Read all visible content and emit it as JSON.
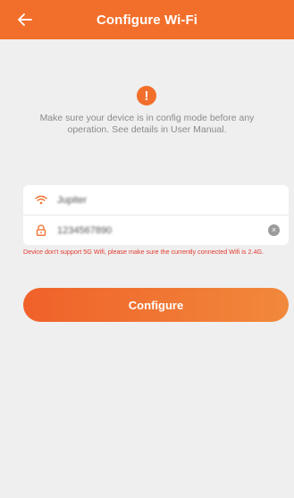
{
  "colors": {
    "accent": "#f26f2b",
    "error": "#e23a2e",
    "background": "#efefef"
  },
  "header": {
    "title": "Configure Wi-Fi",
    "back_icon": "arrow-left-icon"
  },
  "notice": {
    "icon": "exclamation-icon",
    "text": "Make sure your device is in config mode before any operation. See details in User Manual."
  },
  "form": {
    "ssid": {
      "icon": "wifi-icon",
      "value": "Jupiter"
    },
    "password": {
      "icon": "lock-icon",
      "value": "1234567890",
      "clear_icon": "clear-icon"
    }
  },
  "hint": "Device don't support 5G Wifi, please make sure the currently connected Wifi is 2.4G.",
  "configure_button": {
    "label": "Configure"
  }
}
